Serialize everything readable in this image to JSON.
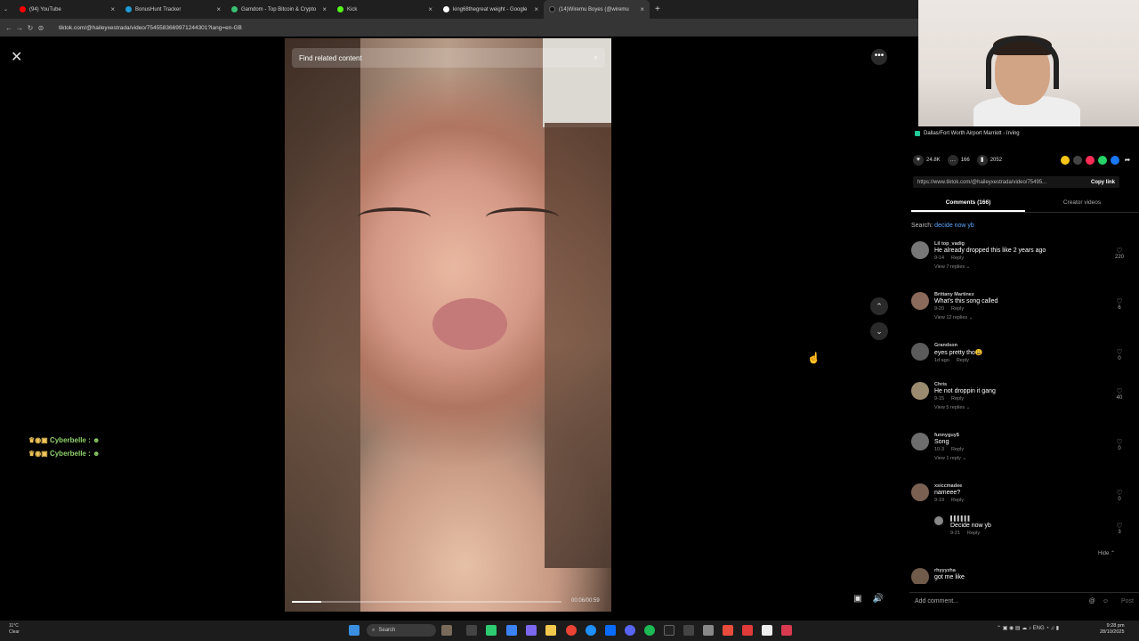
{
  "browser": {
    "tabs": [
      {
        "label": "(94) YouTube",
        "color": "#ff0000",
        "active": false
      },
      {
        "label": "BonusHunt Tracker",
        "color": "#1e9bd7",
        "active": false
      },
      {
        "label": "Gamdom - Top Bitcoin & Crypto",
        "color": "#38c172",
        "active": false
      },
      {
        "label": "Kick",
        "color": "#53fc18",
        "active": false
      },
      {
        "label": "king68thegreat weight - Google",
        "color": "#ffffff",
        "active": false
      },
      {
        "label": "(14)Wiremu Boyes (@wiremu",
        "color": "#111111",
        "active": true
      }
    ],
    "url": "tiktok.com/@haileyxestrada/video/7545583669971244301?lang=en-GB"
  },
  "video": {
    "search_placeholder": "Find related content",
    "time": "00:06/00:59",
    "progress": 0.11
  },
  "chat": [
    {
      "user": "Cyberbelle :"
    },
    {
      "user": "Cyberbelle :"
    }
  ],
  "panel": {
    "location": "Dallas/Fort Worth Airport Marriott - Irving",
    "likes": "24.8K",
    "comments_count": "166",
    "saves": "2052",
    "link": "https://www.tiktok.com/@haileyxestrada/video/75495...",
    "copy_link": "Copy link",
    "tab_comments": "Comments (166)",
    "tab_creator": "Creator videos",
    "search_label": "Search:",
    "search_term": "decide now yb",
    "hide_label": "Hide ⌃",
    "add_comment": "Add comment...",
    "post_label": "Post"
  },
  "comments": [
    {
      "user": "Lil top_vadig",
      "text": "He already dropped this like 2 years ago",
      "date": "9-14",
      "reply": "Reply",
      "replies": "View 7 replies ⌄",
      "likes": "220"
    },
    {
      "user": "Brittany Martinez",
      "text": "What's this song called",
      "date": "9-20",
      "reply": "Reply",
      "replies": "View 12 replies ⌄",
      "likes": "6"
    },
    {
      "user": "Grandson",
      "text": "eyes pretty tho😩",
      "date": "1d ago",
      "reply": "Reply",
      "replies": "",
      "likes": "0"
    },
    {
      "user": "Chris",
      "text": "He not droppin it gang",
      "date": "9-15",
      "reply": "Reply",
      "replies": "View 5 replies ⌄",
      "likes": "40"
    },
    {
      "user": "funnyguy$",
      "text": "Song",
      "date": "10-3",
      "reply": "Reply",
      "replies": "View 1 reply ⌄",
      "likes": "0"
    },
    {
      "user": "xsiccmadee",
      "text": "nameee?",
      "date": "9-19",
      "reply": "Reply",
      "replies": "",
      "likes": "0"
    },
    {
      "user": "rhyyyzha",
      "text": "got me like",
      "date": "",
      "reply": "",
      "replies": "",
      "likes": ""
    }
  ],
  "subreply": {
    "user": "▌▌▌▌▌▌",
    "text": "Decide now yb",
    "date": "9-21",
    "reply": "Reply",
    "likes": "3"
  },
  "taskbar": {
    "weather_temp": "11°C",
    "weather_desc": "Clear",
    "search": "Search",
    "lang": "ENG",
    "time": "9:28 pm",
    "date": "28/10/2025"
  }
}
